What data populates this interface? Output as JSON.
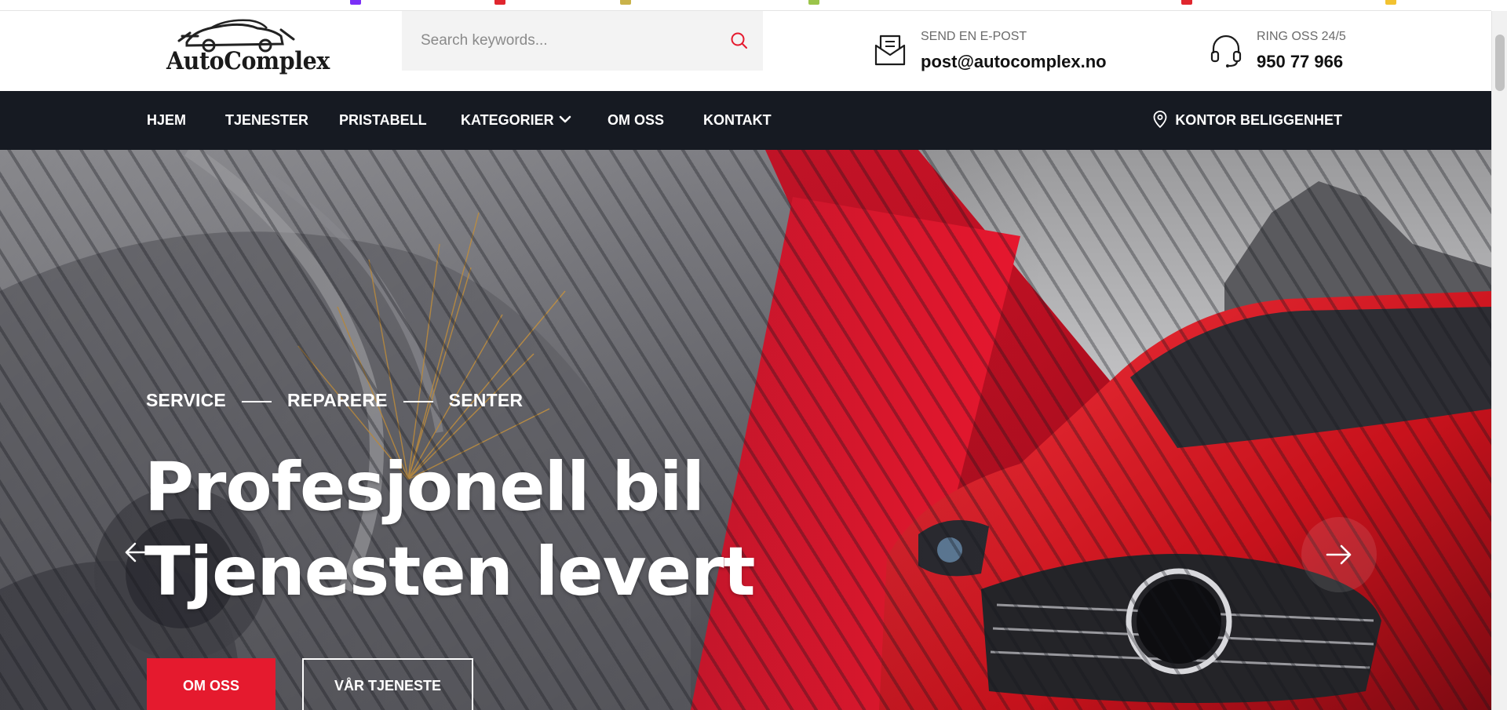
{
  "brand": {
    "name": "AutoComplex"
  },
  "search": {
    "placeholder": "Search keywords..."
  },
  "contact": {
    "email": {
      "label": "SEND EN E-POST",
      "value": "post@autocomplex.no"
    },
    "phone": {
      "label": "RING OSS 24/5",
      "value": "950 77 966"
    }
  },
  "nav": {
    "items": [
      {
        "label": "HJEM"
      },
      {
        "label": "TJENESTER"
      },
      {
        "label": "PRISTABELL"
      },
      {
        "label": "KATEGORIER"
      },
      {
        "label": "OM OSS"
      },
      {
        "label": "KONTAKT"
      }
    ],
    "location_label": "KONTOR BELIGGENHET"
  },
  "hero": {
    "kicker": [
      "SERVICE",
      "REPARERE",
      "SENTER"
    ],
    "headline_line1": "Profesjonell bil",
    "headline_line2": "Tjenesten levert",
    "primary_button": "OM OSS",
    "secondary_button": "VÅR TJENESTE"
  },
  "colors": {
    "accent_red": "#e51a2e",
    "nav_bg": "#161a22",
    "car_red": "#d2161f"
  },
  "icons": {
    "search": "search-icon",
    "email": "envelope-icon",
    "phone": "headset-icon",
    "location": "map-pin-icon",
    "prev": "arrow-left-icon",
    "next": "arrow-right-icon",
    "dropdown": "chevron-down-icon"
  }
}
